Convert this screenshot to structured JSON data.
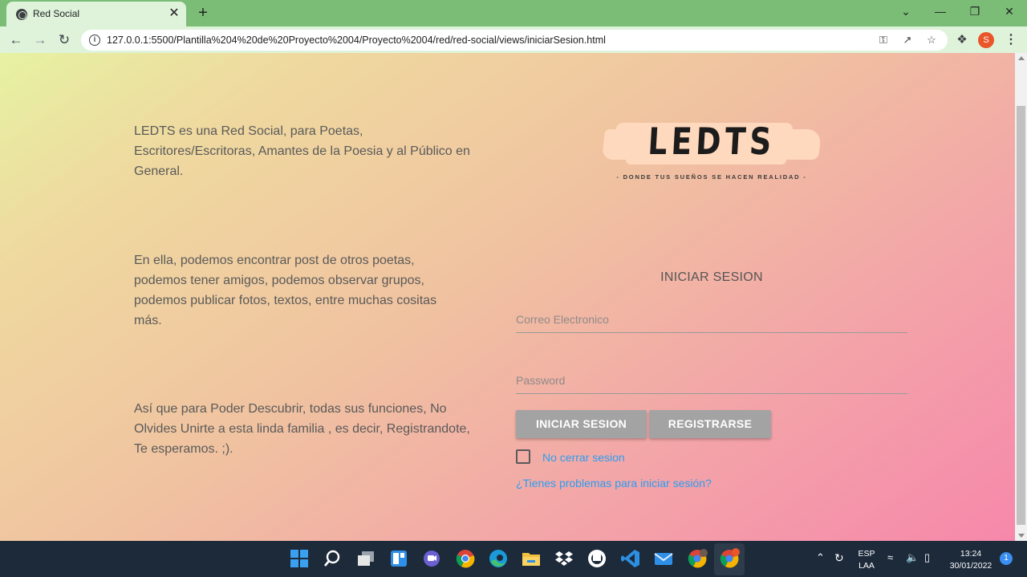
{
  "browser": {
    "tab_title": "Red Social",
    "tab_close": "✕",
    "new_tab": "+",
    "url": "127.0.0.1:5500/Plantilla%204%20de%20Proyecto%2004/Proyecto%2004/red/red-social/views/iniciarSesion.html",
    "icons": [
      "back-arrow-icon",
      "forward-arrow-icon",
      "reload-icon",
      "info-icon",
      "key-icon",
      "share-icon",
      "star-icon",
      "puzzle-icon",
      "menu-dots-icon"
    ],
    "profile_initial": "S",
    "window_controls": {
      "collapse": "⌄",
      "minimize": "—",
      "restore": "❐",
      "close": "✕"
    }
  },
  "page": {
    "paragraphs": [
      "LEDTS es una Red Social, para Poetas, Escritores/Escritoras, Amantes de la Poesia y al Público en General.",
      "En ella, podemos encontrar post de otros poetas, podemos tener amigos, podemos observar grupos, podemos publicar fotos, textos, entre muchas cositas más.",
      "Así que para Poder Descubrir, todas sus funciones, No Olvides Unirte a esta linda familia , es decir, Registrandote, Te esperamos. ;)."
    ],
    "logo": {
      "name": "LEDTS",
      "tagline": "- DONDE TUS SUEÑOS SE HACEN REALIDAD -"
    },
    "login": {
      "title": "INICIAR SESION",
      "email_placeholder": "Correo Electronico",
      "password_placeholder": "Password",
      "login_button": "INICIAR SESION",
      "register_button": "REGISTRARSE",
      "remember_label": "No cerrar sesion",
      "trouble_link": "¿Tienes problemas para iniciar sesión?"
    }
  },
  "taskbar": {
    "apps": [
      "windows-start-icon",
      "search-icon",
      "task-view-icon",
      "widgets-icon",
      "teams-chat-icon",
      "chrome-icon",
      "edge-icon",
      "file-explorer-icon",
      "dropbox-icon",
      "github-icon",
      "vscode-icon",
      "mail-icon",
      "chrome-profile-icon",
      "chrome-active-icon"
    ],
    "language": "ESP",
    "layout": "LAA",
    "time": "13:24",
    "date": "30/01/2022",
    "notifications": "1"
  },
  "colors": {
    "tab_strip": "#7bbd76",
    "toolbar": "#dff3db",
    "gradient_start": "#e6f2a3",
    "gradient_end": "#f688ab",
    "button_gray": "#a3a3a3",
    "link_blue": "#2a9ef1",
    "taskbar": "#1c2a3a"
  }
}
